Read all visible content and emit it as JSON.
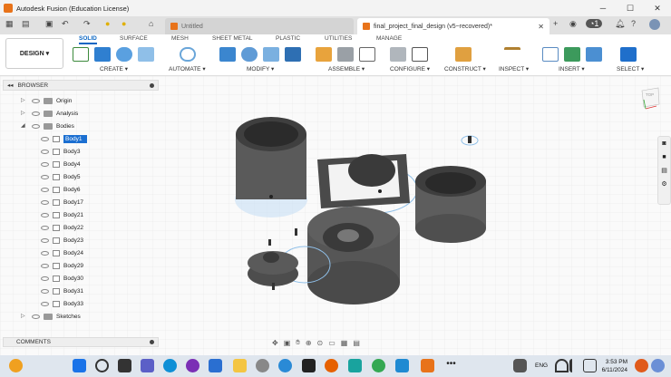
{
  "window": {
    "title": "Autodesk Fusion (Education License)"
  },
  "tabs": [
    {
      "label": "Untitled"
    },
    {
      "label": "final_project_final_design (v5~recovered)*"
    }
  ],
  "toolbar": {
    "workspace": "DESIGN",
    "ws_tabs": [
      "SOLID",
      "SURFACE",
      "MESH",
      "SHEET METAL",
      "PLASTIC",
      "UTILITIES",
      "MANAGE"
    ],
    "groups": [
      "CREATE",
      "AUTOMATE",
      "MODIFY",
      "ASSEMBLE",
      "CONFIGURE",
      "CONSTRUCT",
      "INSPECT",
      "INSERT",
      "SELECT"
    ]
  },
  "browser": {
    "title": "BROWSER",
    "items": [
      "Origin",
      "Analysis",
      "Bodies",
      "Body1",
      "Body3",
      "Body4",
      "Body5",
      "Body6",
      "Body17",
      "Body21",
      "Body22",
      "Body23",
      "Body24",
      "Body29",
      "Body30",
      "Body31",
      "Body33",
      "Sketches"
    ]
  },
  "comments": {
    "label": "COMMENTS"
  },
  "viewcube": {
    "label": "TOP"
  },
  "taskbar": {
    "lang": "ENG",
    "time": "3:53 PM",
    "date": "6/11/2024"
  },
  "icons": [
    "grid-icon",
    "file-icon",
    "save-icon",
    "undo-icon",
    "redo-icon",
    "bulb-icon",
    "home-icon",
    "close-icon",
    "add-icon",
    "eye-icon",
    "folder-icon",
    "gear-icon",
    "camera-icon",
    "search-icon",
    "windows-icon"
  ]
}
